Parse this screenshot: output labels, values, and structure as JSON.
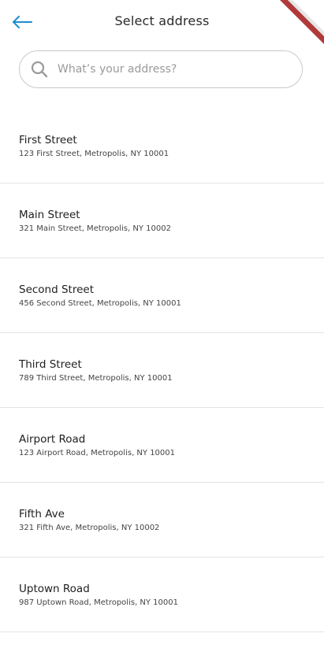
{
  "header": {
    "title": "Select address",
    "back_icon": "arrow-left-icon",
    "accent_color": "#1a8fd0"
  },
  "search": {
    "placeholder": "What’s your address?",
    "value": "",
    "icon": "search-icon"
  },
  "addresses": [
    {
      "name": "First Street",
      "detail": "123 First Street, Metropolis, NY 10001"
    },
    {
      "name": "Main Street",
      "detail": "321 Main Street, Metropolis, NY 10002"
    },
    {
      "name": "Second Street",
      "detail": "456 Second Street, Metropolis, NY 10001"
    },
    {
      "name": "Third Street",
      "detail": "789 Third Street, Metropolis, NY 10001"
    },
    {
      "name": "Airport Road",
      "detail": "123 Airport Road, Metropolis, NY 10001"
    },
    {
      "name": "Fifth Ave",
      "detail": "321 Fifth Ave, Metropolis, NY 10002"
    },
    {
      "name": "Uptown Road",
      "detail": "987 Uptown Road, Metropolis, NY 10001"
    }
  ],
  "colors": {
    "debug_ribbon": "#b03a3a"
  }
}
